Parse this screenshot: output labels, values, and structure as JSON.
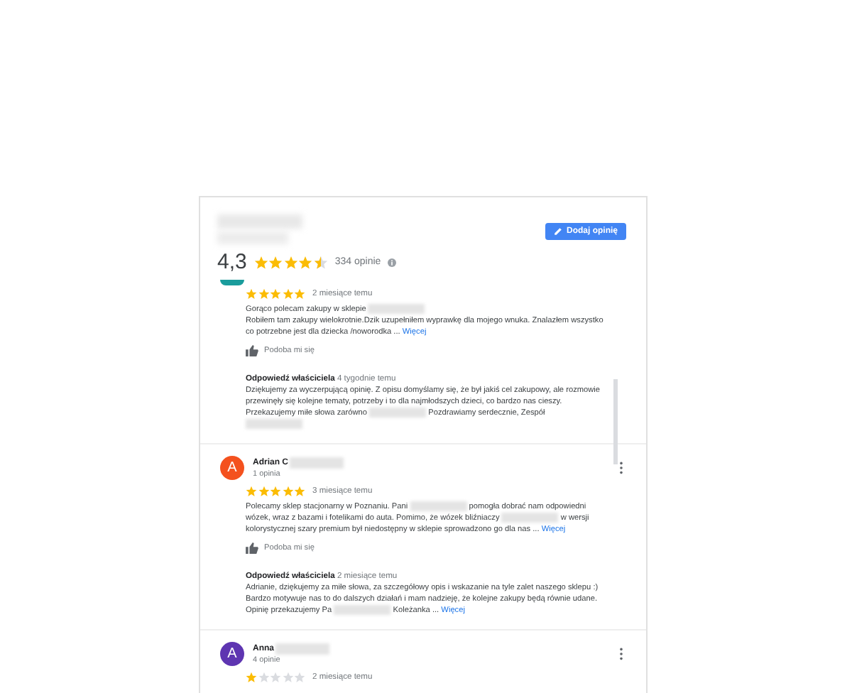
{
  "header": {
    "rating": "4,3",
    "stars": 4.5,
    "count": "334 opinie",
    "add_button": "Dodaj opinię"
  },
  "reviews": [
    {
      "kind": "cut",
      "color": "#1a9c9c",
      "stars": 5,
      "time": "2 miesiące temu",
      "text": [
        "Gorąco polecam zakupy w sklepie",
        "\nRobiłem tam zakupy wielokrotnie.Dzik uzupełniłem wyprawkę dla mojego wnuka. Znalazłem wszystko co potrzebne jest dla dziecka /noworodka ..."
      ],
      "more": "Więcej",
      "like": "Podoba mi się",
      "reply": {
        "label": "Odpowiedź właściciela",
        "time": "4 tygodnie temu",
        "text": [
          "Dziękujemy za wyczerpującą opinię. Z opisu domyślamy się, że był jakiś cel zakupowy, ale rozmowie przewinęły się kolejne tematy, potrzeby i to dla najmłodszych dzieci, co bardzo nas cieszy. Przekazujemy miłe słowa zarówno",
          "Pozdrawiamy serdecznie, Zespół"
        ],
        "ends_redacted": true
      }
    },
    {
      "kind": "full",
      "avatar_letter": "A",
      "color": "#f4511e",
      "name": "Adrian C",
      "reviews_count": "1 opinia",
      "stars": 5,
      "time": "3 miesiące temu",
      "text": [
        "Polecamy sklep stacjonarny w Poznaniu. Pani",
        "pomogła dobrać nam odpowiedni wózek, wraz z bazami i fotelikami do auta. Pomimo, że wózek bliźniaczy",
        "w wersji kolorystycznej szary premium był niedostępny w sklepie sprowadzono go dla nas ..."
      ],
      "more": "Więcej",
      "like": "Podoba mi się",
      "reply": {
        "label": "Odpowiedź właściciela",
        "time": "2 miesiące temu",
        "text": [
          "Adrianie, dziękujemy za miłe słowa, za szczegółowy opis i wskazanie na tyle zalet naszego sklepu :)\nBardzo motywuje nas to do dalszych działań i mam nadzieję, że kolejne zakupy będą równie udane.\nOpinię przekazujemy Pa",
          "Koleżanka ..."
        ],
        "more": "Więcej",
        "ends_redacted": false
      }
    },
    {
      "kind": "full",
      "avatar_letter": "A",
      "color": "#5e35b1",
      "name": "Anna",
      "reviews_count": "4 opinie",
      "stars": 1,
      "time": "2 miesiące temu"
    }
  ]
}
